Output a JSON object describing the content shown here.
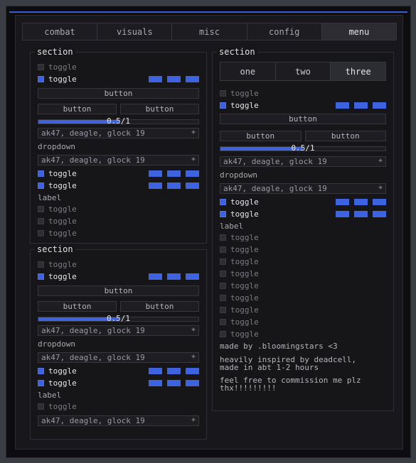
{
  "tabs": [
    {
      "label": "combat",
      "active": false
    },
    {
      "label": "visuals",
      "active": false
    },
    {
      "label": "misc",
      "active": false
    },
    {
      "label": "config",
      "active": false
    },
    {
      "label": "menu",
      "active": true
    }
  ],
  "accent_color": "#3d63e0",
  "left_top": {
    "title": "section",
    "toggle_off": "toggle",
    "toggle_on": "toggle",
    "button": "button",
    "button_a": "button",
    "button_b": "button",
    "slider_value": "0.5/1",
    "slider_fraction": 0.5,
    "dropdown1": "ak47, deagle, glock 19",
    "dropdown_label": "dropdown",
    "dropdown2": "ak47, deagle, glock 19",
    "toggle_c1": "toggle",
    "toggle_c2": "toggle",
    "label": "label",
    "toggle_l1": "toggle",
    "toggle_l2": "toggle",
    "toggle_l3": "toggle"
  },
  "left_bottom": {
    "title": "section",
    "toggle_off": "toggle",
    "toggle_on": "toggle",
    "button": "button",
    "button_a": "button",
    "button_b": "button",
    "slider_value": "0.5/1",
    "slider_fraction": 0.5,
    "dropdown1": "ak47, deagle, glock 19",
    "dropdown_label": "dropdown",
    "dropdown2": "ak47, deagle, glock 19",
    "toggle_c1": "toggle",
    "toggle_c2": "toggle",
    "label": "label",
    "toggle_l1": "toggle",
    "dropdown3": "ak47, deagle, glock 19"
  },
  "right": {
    "title": "section",
    "segments": [
      "one",
      "two",
      "three"
    ],
    "active_segment": "three",
    "toggle_off": "toggle",
    "toggle_on": "toggle",
    "button": "button",
    "button_a": "button",
    "button_b": "button",
    "slider_value": "0.5/1",
    "slider_fraction": 0.5,
    "dropdown1": "ak47, deagle, glock 19",
    "dropdown_label": "dropdown",
    "dropdown2": "ak47, deagle, glock 19",
    "toggle_c1": "toggle",
    "toggle_c2": "toggle",
    "label": "label",
    "toggle_list": [
      "toggle",
      "toggle",
      "toggle",
      "toggle",
      "toggle",
      "toggle",
      "toggle",
      "toggle",
      "toggle"
    ],
    "credit1": "made by .bloomingstars <3",
    "credit2_line1": "heavily inspired by deadcell,",
    "credit2_line2": "made in abt 1-2 hours",
    "credit3_line1": "feel free to commission me plz",
    "credit3_line2": "thx!!!!!!!!!"
  }
}
